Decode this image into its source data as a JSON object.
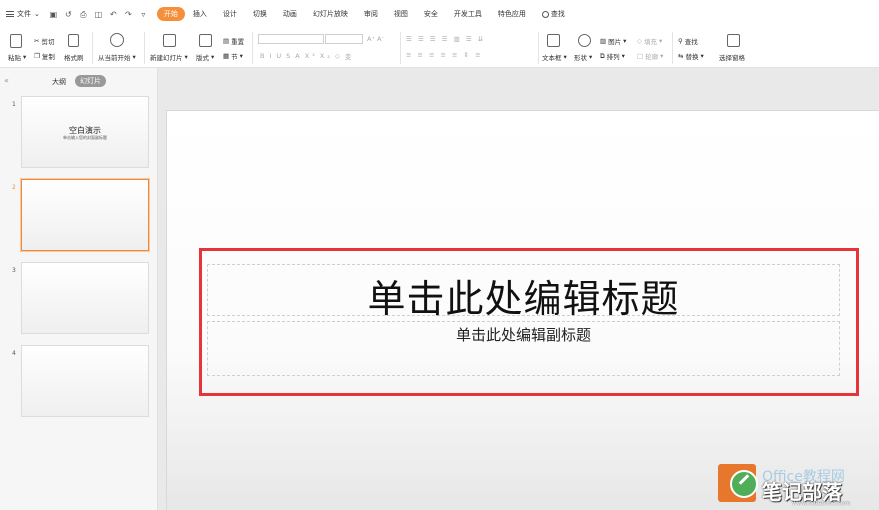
{
  "menubar": {
    "file_label": "文件",
    "tabs": [
      "开始",
      "插入",
      "设计",
      "切换",
      "动画",
      "幻灯片放映",
      "审阅",
      "视图",
      "安全",
      "开发工具",
      "特色应用"
    ],
    "search_label": "查找",
    "active_color": "#f58f3b"
  },
  "ribbon": {
    "paste": "粘贴",
    "cut": "剪切",
    "copy": "复制",
    "format_painter": "格式刷",
    "from_current": "从当前开始",
    "new_slide": "新建幻灯片",
    "layout": "版式",
    "reset": "重置",
    "section": "节",
    "font_buttons": [
      "B",
      "I",
      "U",
      "S",
      "A",
      "X²",
      "X₂",
      "◇",
      "变"
    ],
    "textbox": "文本框",
    "shape": "形状",
    "picture": "图片",
    "arrange": "排列",
    "fill": "填充",
    "outline": "轮廓",
    "find": "查找",
    "replace": "替换",
    "selection_pane": "选择窗格"
  },
  "sidebar": {
    "outline_tab": "大纲",
    "slides_tab": "幻灯片",
    "slides": [
      {
        "num": "1",
        "title": "空白演示",
        "subtitle": "单击输入您的封面副标题"
      },
      {
        "num": "2"
      },
      {
        "num": "3"
      },
      {
        "num": "4"
      }
    ]
  },
  "slide": {
    "title_placeholder": "单击此处编辑标题",
    "subtitle_placeholder": "单击此处编辑副标题",
    "highlight_color": "#e5343a"
  },
  "watermark": {
    "faded_text": "Office教程网",
    "text": "笔记部落",
    "url": "www.notetribe.com"
  }
}
